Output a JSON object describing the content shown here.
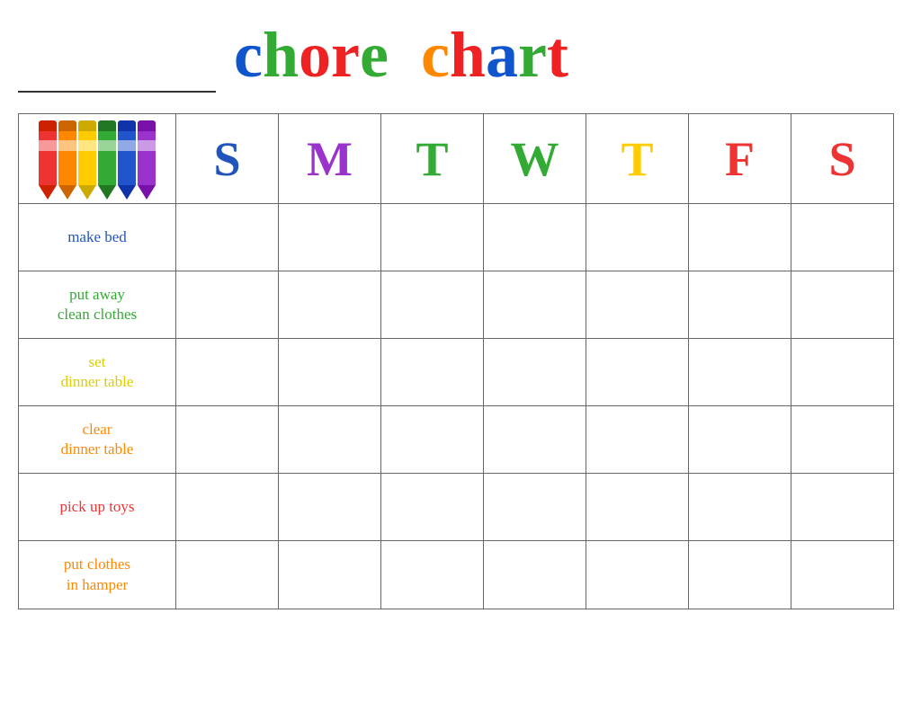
{
  "header": {
    "title_word1": "chore",
    "title_word2": "chart",
    "name_placeholder": ""
  },
  "days": {
    "headers": [
      "S",
      "M",
      "T",
      "W",
      "T",
      "F",
      "S"
    ],
    "colors": [
      "#2255bb",
      "#33aa33",
      "#ee3333",
      "#33aa33",
      "#ffaa00",
      "#ee3333",
      "#ee3333"
    ]
  },
  "chores": [
    {
      "label": "make bed",
      "color": "#2255bb",
      "lines": [
        "make bed"
      ]
    },
    {
      "label": "put away clean clothes",
      "color": "#33aa33",
      "lines": [
        "put away",
        "clean clothes"
      ]
    },
    {
      "label": "set dinner table",
      "color": "#ffcc00",
      "lines": [
        "set",
        "dinner table"
      ]
    },
    {
      "label": "clear dinner table",
      "color": "#ff8800",
      "lines": [
        "clear",
        "dinner table"
      ]
    },
    {
      "label": "pick up toys",
      "color": "#ee3333",
      "lines": [
        "pick up toys"
      ]
    },
    {
      "label": "put clothes in hamper",
      "color": "#ff8800",
      "lines": [
        "put clothes",
        "in hamper"
      ]
    }
  ],
  "crayons": [
    {
      "color": "#ee3333",
      "tip": "#cc2200"
    },
    {
      "color": "#ff8800",
      "tip": "#cc6600"
    },
    {
      "color": "#ffcc00",
      "tip": "#ccaa00"
    },
    {
      "color": "#33aa33",
      "tip": "#227722"
    },
    {
      "color": "#2255cc",
      "tip": "#1133aa"
    },
    {
      "color": "#9933cc",
      "tip": "#7711aa"
    }
  ]
}
